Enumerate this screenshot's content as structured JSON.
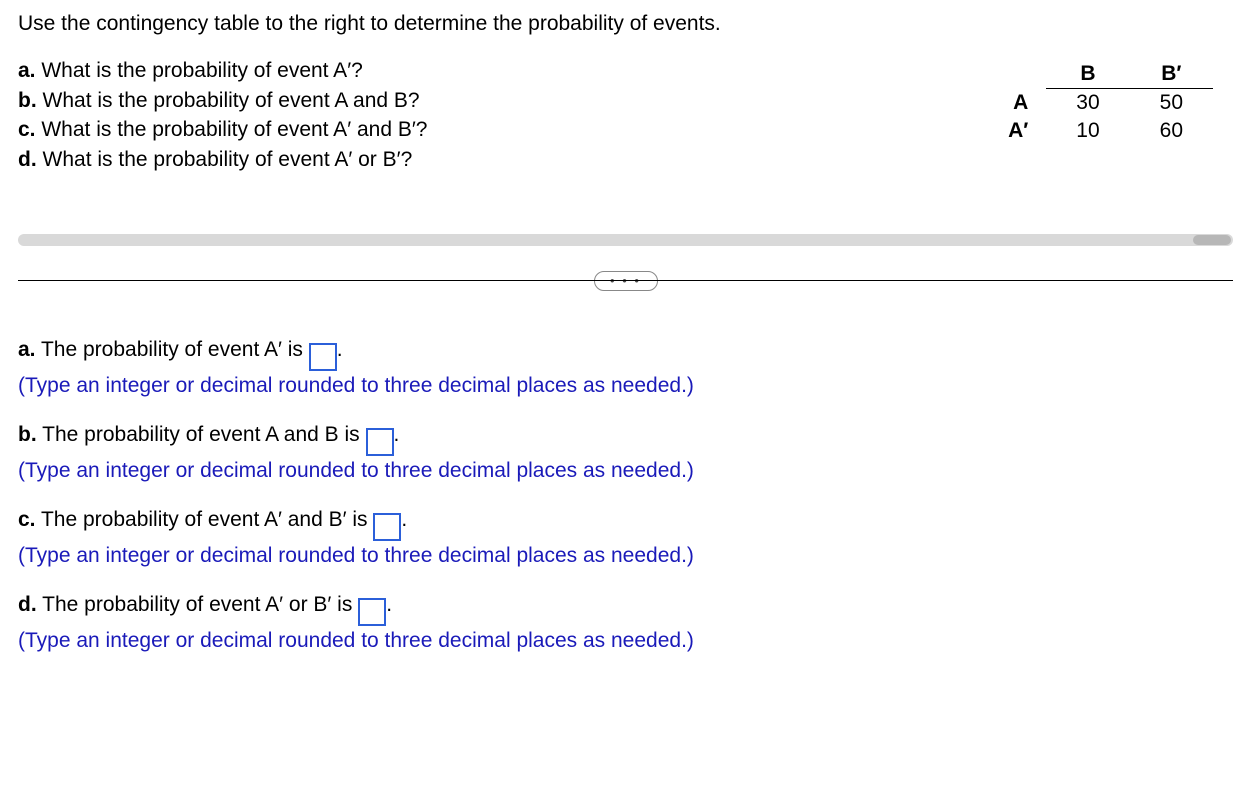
{
  "instruction": "Use the contingency table to the right to determine the probability of events.",
  "questions": {
    "a": {
      "label": "a.",
      "text": "What is the probability of event A′?"
    },
    "b": {
      "label": "b.",
      "text": "What is the probability of event A and B?"
    },
    "c": {
      "label": "c.",
      "text": "What is the probability of event A′ and B′?"
    },
    "d": {
      "label": "d.",
      "text": "What is the probability of event A′ or B′?"
    }
  },
  "table": {
    "col_headers": {
      "b": "B",
      "b_prime": "B′"
    },
    "rows": [
      {
        "label": "A",
        "b": "30",
        "b_prime": "50"
      },
      {
        "label": "A′",
        "b": "10",
        "b_prime": "60"
      }
    ]
  },
  "more_label": "• • •",
  "answers": {
    "a": {
      "label": "a.",
      "pre": "The probability of event A′ is ",
      "post": ".",
      "hint": "(Type an integer or decimal rounded to three decimal places as needed.)"
    },
    "b": {
      "label": "b.",
      "pre": "The probability of event A and B is ",
      "post": ".",
      "hint": "(Type an integer or decimal rounded to three decimal places as needed.)"
    },
    "c": {
      "label": "c.",
      "pre": "The probability of event A′ and B′ is ",
      "post": ".",
      "hint": "(Type an integer or decimal rounded to three decimal places as needed.)"
    },
    "d": {
      "label": "d.",
      "pre": "The probability of event A′ or B′ is ",
      "post": ".",
      "hint": "(Type an integer or decimal rounded to three decimal places as needed.)"
    }
  }
}
